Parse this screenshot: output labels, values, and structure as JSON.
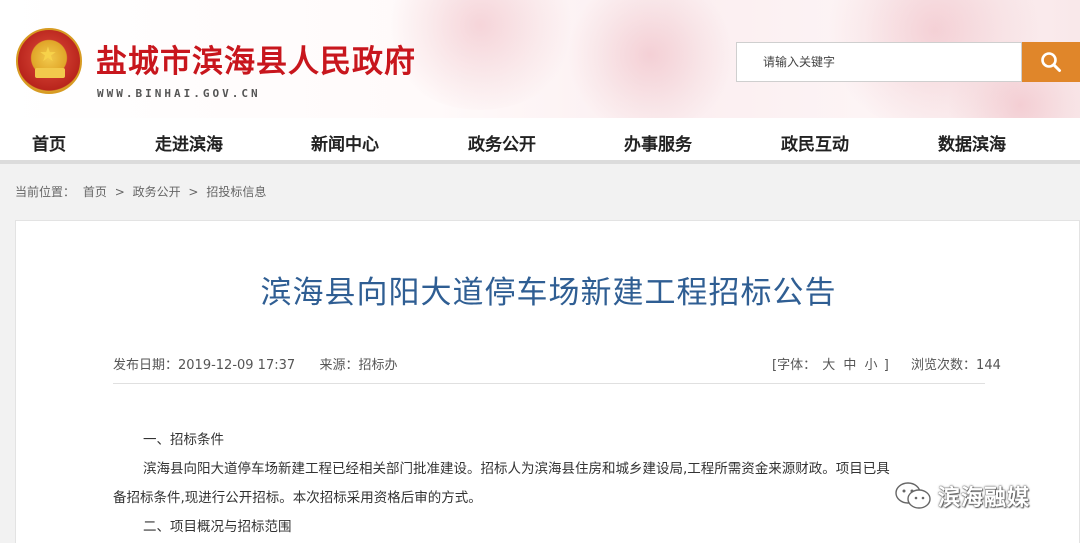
{
  "header": {
    "site_title": "盐城市滨海县人民政府",
    "site_url": "WWW.BINHAI.GOV.CN",
    "search_placeholder": "请输入关键字"
  },
  "nav": {
    "items": [
      {
        "label": "首页"
      },
      {
        "label": "走进滨海"
      },
      {
        "label": "新闻中心"
      },
      {
        "label": "政务公开"
      },
      {
        "label": "办事服务"
      },
      {
        "label": "政民互动"
      },
      {
        "label": "数据滨海"
      }
    ]
  },
  "breadcrumb": {
    "prefix": "当前位置：",
    "items": [
      "首页",
      "政务公开",
      "招投标信息"
    ],
    "separator": ">"
  },
  "article": {
    "title": "滨海县向阳大道停车场新建工程招标公告",
    "publish_label": "发布日期：2019-12-09 17:37",
    "source_label": "来源：招标办",
    "font_size_prefix": "[字体：",
    "font_sizes": [
      "大",
      "中",
      "小"
    ],
    "font_size_suffix": "]",
    "views_label": "浏览次数：144",
    "paragraphs": [
      "一、招标条件",
      "滨海县向阳大道停车场新建工程已经相关部门批准建设。招标人为滨海县住房和城乡建设局,工程所需资金来源财政。项目已具",
      "备招标条件,现进行公开招标。本次招标采用资格后审的方式。",
      "二、项目概况与招标范围"
    ]
  },
  "watermark": {
    "text": "滨海融媒",
    "icon": "wechat-icon"
  },
  "colors": {
    "brand_red": "#c8161d",
    "title_blue": "#2f5e93",
    "search_orange": "#e0862a"
  }
}
